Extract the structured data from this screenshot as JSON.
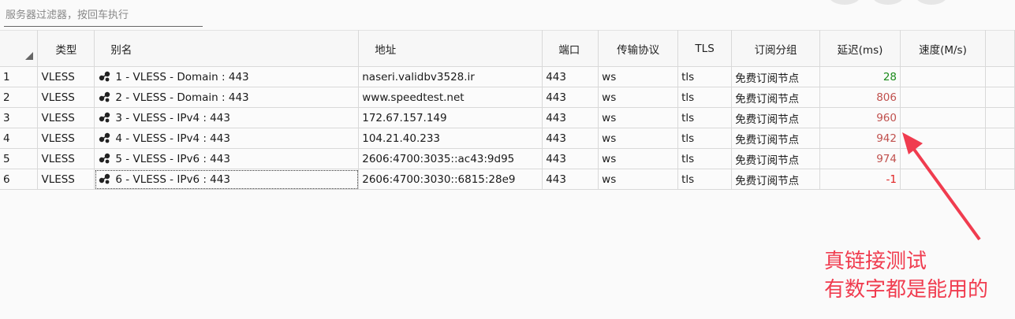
{
  "filter": {
    "placeholder": "服务器过滤器，按回车执行"
  },
  "columns": [
    "类型",
    "别名",
    "地址",
    "端口",
    "传输协议",
    "TLS",
    "订阅分组",
    "延迟(ms)",
    "速度(M/s)"
  ],
  "rows": [
    {
      "idx": "1",
      "type": "VLESS",
      "alias": "1 - VLESS - Domain : 443",
      "address": "naseri.validbv3528.ir",
      "port": "443",
      "transport": "ws",
      "tls": "tls",
      "group": "免费订阅节点",
      "delay": "28",
      "delay_color": "#1a8a1a",
      "speed": ""
    },
    {
      "idx": "2",
      "type": "VLESS",
      "alias": "2 - VLESS - Domain : 443",
      "address": "www.speedtest.net",
      "port": "443",
      "transport": "ws",
      "tls": "tls",
      "group": "免费订阅节点",
      "delay": "806",
      "delay_color": "#c0504d",
      "speed": ""
    },
    {
      "idx": "3",
      "type": "VLESS",
      "alias": "3 - VLESS - IPv4 : 443",
      "address": "172.67.157.149",
      "port": "443",
      "transport": "ws",
      "tls": "tls",
      "group": "免费订阅节点",
      "delay": "960",
      "delay_color": "#c0504d",
      "speed": ""
    },
    {
      "idx": "4",
      "type": "VLESS",
      "alias": "4 - VLESS - IPv4 : 443",
      "address": "104.21.40.233",
      "port": "443",
      "transport": "ws",
      "tls": "tls",
      "group": "免费订阅节点",
      "delay": "942",
      "delay_color": "#c0504d",
      "speed": ""
    },
    {
      "idx": "5",
      "type": "VLESS",
      "alias": "5 - VLESS - IPv6 : 443",
      "address": "2606:4700:3035::ac43:9d95",
      "port": "443",
      "transport": "ws",
      "tls": "tls",
      "group": "免费订阅节点",
      "delay": "974",
      "delay_color": "#c0504d",
      "speed": ""
    },
    {
      "idx": "6",
      "type": "VLESS",
      "alias": "6 - VLESS - IPv6 : 443",
      "address": "2606:4700:3030::6815:28e9",
      "port": "443",
      "transport": "ws",
      "tls": "tls",
      "group": "免费订阅节点",
      "delay": "-1",
      "delay_color": "#e02020",
      "speed": ""
    }
  ],
  "annotation": {
    "line1": "真链接测试",
    "line2": "有数字都是能用的",
    "color": "#f03c4f"
  }
}
